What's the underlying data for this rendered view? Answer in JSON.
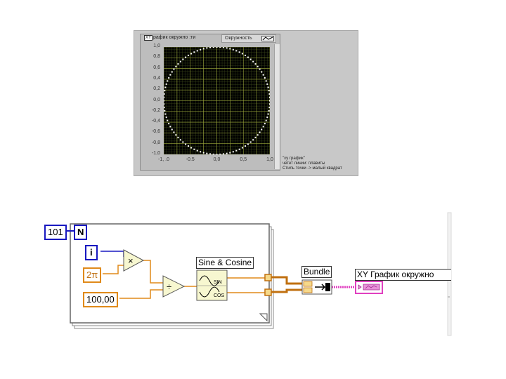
{
  "front_panel": {
    "graph_label": "рафик окружно :ти",
    "graph_tag": "XY",
    "plot_legend_label": "Окружность",
    "y_ticks": [
      "1,0",
      "0,8",
      "0,6",
      "0,4",
      "0,2",
      "0,0",
      "-0,2",
      "-0,4",
      "-0,6",
      "-0,8",
      "-1,0"
    ],
    "x_ticks": [
      "-1, .0",
      "-0.5",
      "0,0",
      "0,5",
      "1,0"
    ],
    "legend_lines": [
      "\"xy график\"",
      "четет линии: плавиты",
      "Стиль точки -> малый квадрат"
    ]
  },
  "chart_data": {
    "type": "scatter",
    "title": "",
    "x_label": "",
    "y_label": "",
    "xlim": [
      -1,
      1
    ],
    "ylim": [
      -1,
      1
    ],
    "grid": true,
    "points_count": 101,
    "shape": "unit circle (x=cos t, y=sin t)",
    "series": [
      {
        "name": "Окружность",
        "color": "#ffffff"
      }
    ],
    "background": "#000000",
    "grid_color": "#9aa63a"
  },
  "block_diagram": {
    "count_constant": "101",
    "count_terminal": "N",
    "iteration_terminal": "i",
    "two_pi_constant": "2π",
    "divisor_constant": "100,00",
    "multiply_symbol": "×",
    "divide_symbol": "÷",
    "sine_cosine_label": "Sine & Cosine",
    "sin_label": "SIN",
    "cos_label": "COS",
    "bundle_label": "Bundle",
    "graph_indicator_label": "XY График окружно",
    "colors": {
      "integer_wire": "#1818c0",
      "double_wire": "#e08a1a",
      "cluster_wire": "#e040c0"
    }
  }
}
